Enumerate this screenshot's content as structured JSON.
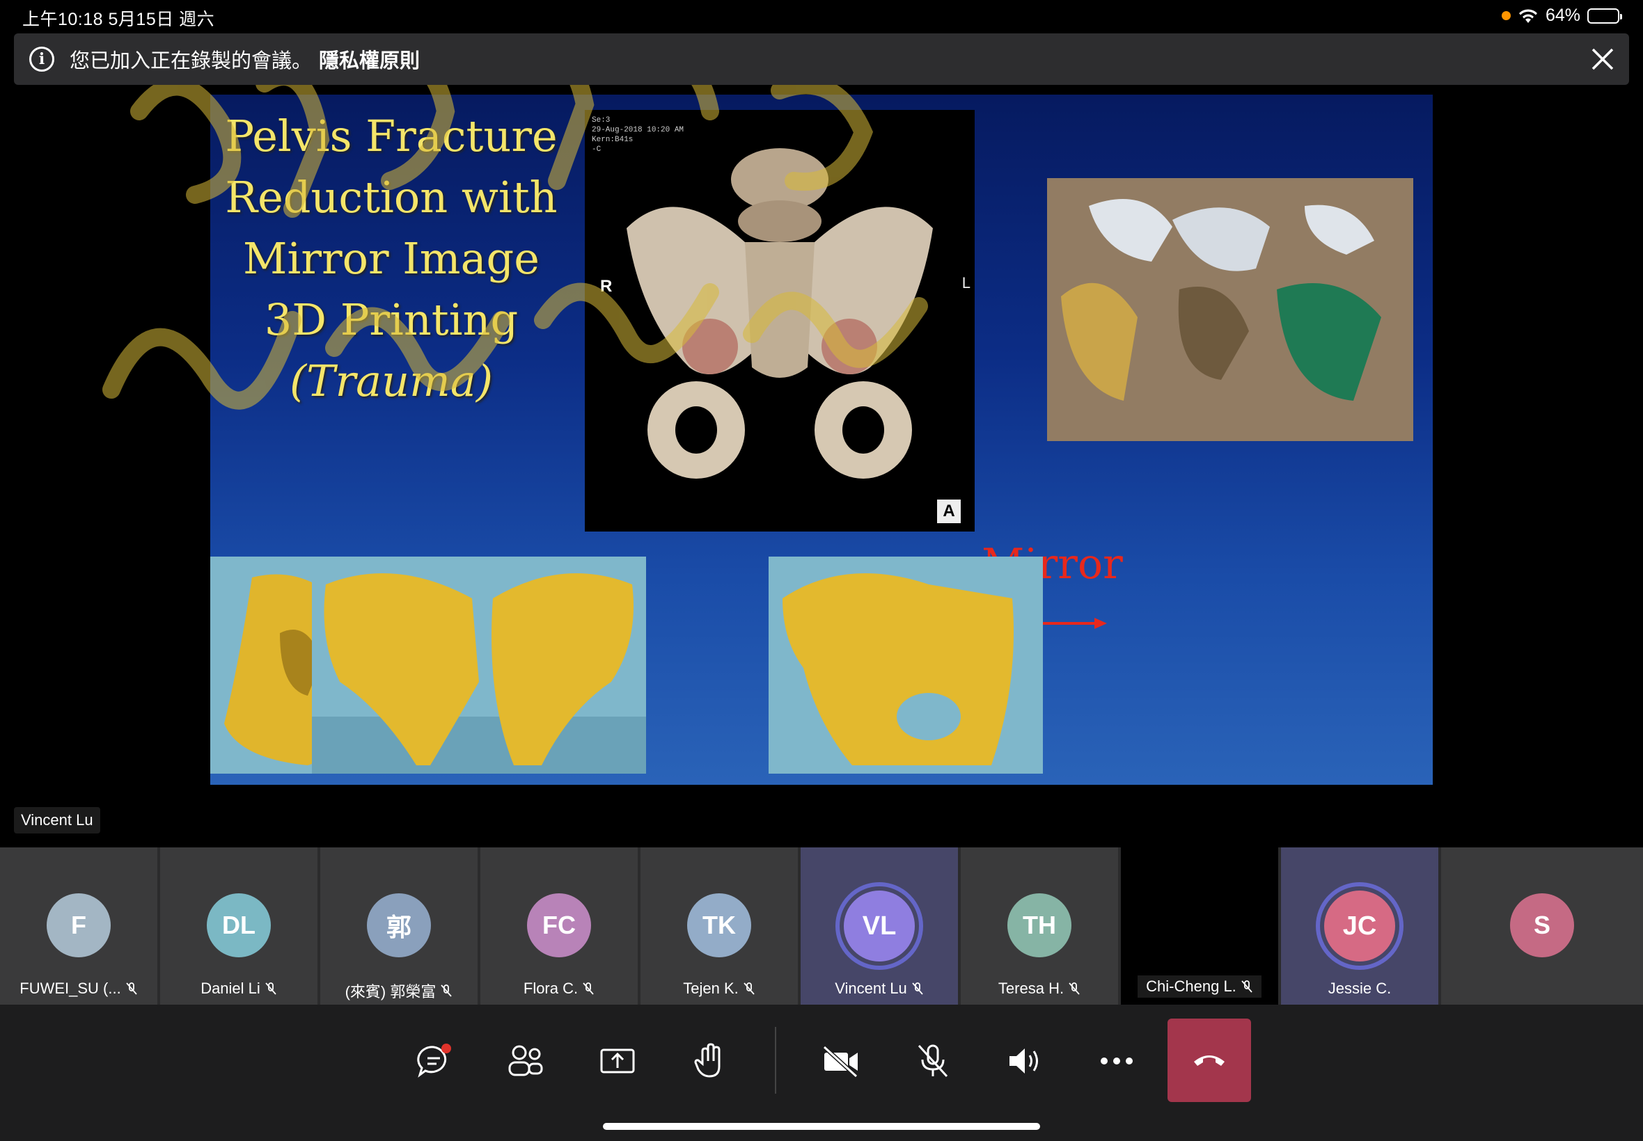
{
  "status_bar": {
    "time": "上午10:18   5月15日 週六",
    "battery": "64%",
    "battery_level": 0.64
  },
  "banner": {
    "message": "您已加入正在錄製的會議。",
    "link": "隱私權原則"
  },
  "slide": {
    "title_lines": [
      "Pelvis Fracture",
      "Reduction with",
      "Mirror Image",
      "3D Printing"
    ],
    "title_italic": "(Trauma)",
    "ct_meta": [
      "Se:3",
      "29-Aug-2018 10:20 AM",
      "Kern:B41s",
      "-C"
    ],
    "ct_r": "R",
    "ct_l": "L",
    "ct_a": "A",
    "mirror_label": "Mirror"
  },
  "presenter": "Vincent Lu",
  "participants": [
    {
      "initials": "F",
      "name": "FUWEI_SU (...",
      "color": "#a3b6c4",
      "muted": true
    },
    {
      "initials": "DL",
      "name": "Daniel Li",
      "color": "#7bb8c4",
      "muted": true
    },
    {
      "initials": "郭",
      "name": "(來賓) 郭榮富",
      "color": "#8aa0bc",
      "muted": true
    },
    {
      "initials": "FC",
      "name": "Flora C.",
      "color": "#b883b8",
      "muted": true
    },
    {
      "initials": "TK",
      "name": "Tejen K.",
      "color": "#93acc8",
      "muted": true
    },
    {
      "initials": "VL",
      "name": "Vincent Lu",
      "color": "#8f7ee0",
      "muted": true,
      "speaking": true
    },
    {
      "initials": "TH",
      "name": "Teresa H.",
      "color": "#86b4a5",
      "muted": true
    },
    {
      "initials": "",
      "name": "Chi-Cheng L.",
      "color": "#000000",
      "muted": true,
      "video": true
    },
    {
      "initials": "JC",
      "name": "Jessie C.",
      "color": "#d66a84",
      "muted": false,
      "speaking": true
    },
    {
      "initials": "S",
      "name": "",
      "color": "#c56a84",
      "muted": false
    }
  ],
  "controls": [
    "chat-icon",
    "people-icon",
    "share-icon",
    "raise-hand-icon",
    "camera-off-icon",
    "mic-off-icon",
    "speaker-icon",
    "more-icon",
    "hang-up-icon"
  ]
}
